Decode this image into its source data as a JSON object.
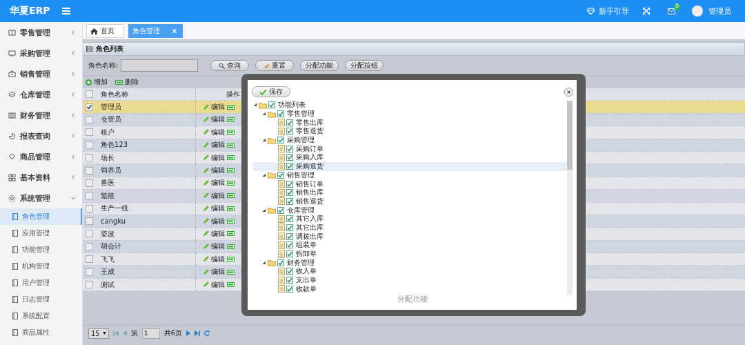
{
  "header": {
    "logo": "华夏ERP",
    "guide": "新手引导",
    "mail_badge": "0",
    "user": "管理员"
  },
  "sidebar": {
    "items": [
      {
        "label": "零售管理",
        "expanded": false
      },
      {
        "label": "采购管理",
        "expanded": false
      },
      {
        "label": "销售管理",
        "expanded": false
      },
      {
        "label": "仓库管理",
        "expanded": false
      },
      {
        "label": "财务管理",
        "expanded": false
      },
      {
        "label": "报表查询",
        "expanded": false
      },
      {
        "label": "商品管理",
        "expanded": false
      },
      {
        "label": "基本资料",
        "expanded": false
      },
      {
        "label": "系统管理",
        "expanded": true,
        "children": [
          {
            "label": "角色管理",
            "selected": true
          },
          {
            "label": "应用管理",
            "selected": false
          },
          {
            "label": "功能管理",
            "selected": false
          },
          {
            "label": "机构管理",
            "selected": false
          },
          {
            "label": "用户管理",
            "selected": false
          },
          {
            "label": "日志管理",
            "selected": false
          },
          {
            "label": "系统配置",
            "selected": false
          },
          {
            "label": "商品属性",
            "selected": false
          }
        ]
      }
    ]
  },
  "tabs": [
    {
      "label": "首页",
      "selected": false,
      "closable": false
    },
    {
      "label": "角色管理",
      "selected": true,
      "closable": true
    }
  ],
  "panel": {
    "title": "角色列表",
    "search_label": "角色名称:",
    "buttons": [
      "查询",
      "重置",
      "分配功能",
      "分配按钮"
    ],
    "toolbar": [
      "增加",
      "删除"
    ]
  },
  "table": {
    "all_checked": false,
    "columns": [
      "角色名称",
      "操作"
    ],
    "rows": [
      {
        "name": "管理员",
        "selected": true,
        "edit": "编辑"
      },
      {
        "name": "仓管员",
        "selected": false,
        "edit": "编辑"
      },
      {
        "name": "租户",
        "selected": false,
        "edit": "编辑"
      },
      {
        "name": "角色123",
        "selected": false,
        "edit": "编辑"
      },
      {
        "name": "场长",
        "selected": false,
        "edit": "编辑"
      },
      {
        "name": "饲养员",
        "selected": false,
        "edit": "编辑"
      },
      {
        "name": "兽医",
        "selected": false,
        "edit": "编辑"
      },
      {
        "name": "繁殖",
        "selected": false,
        "edit": "编辑"
      },
      {
        "name": "生产一线",
        "selected": false,
        "edit": "编辑"
      },
      {
        "name": "cangku",
        "selected": false,
        "edit": "编辑"
      },
      {
        "name": "姿波",
        "selected": false,
        "edit": "编辑"
      },
      {
        "name": "胡会计",
        "selected": false,
        "edit": "编辑"
      },
      {
        "name": "飞飞",
        "selected": false,
        "edit": "编辑"
      },
      {
        "name": "王成",
        "selected": false,
        "edit": "编辑"
      },
      {
        "name": "测试",
        "selected": false,
        "edit": "编辑"
      }
    ]
  },
  "pager": {
    "page_size": "15",
    "page_prefix": "第",
    "page": "1",
    "total": "共6页"
  },
  "dialog": {
    "save": "保存",
    "footer": "分配功能",
    "tree": {
      "label": "功能列表",
      "checked": true,
      "expanded": true,
      "selected": false,
      "children": [
        {
          "label": "零售管理",
          "checked": true,
          "expanded": true,
          "selected": false,
          "children": [
            {
              "label": "零售出库",
              "checked": true,
              "selected": false
            },
            {
              "label": "零售退货",
              "checked": true,
              "selected": false
            }
          ]
        },
        {
          "label": "采购管理",
          "checked": true,
          "expanded": true,
          "selected": false,
          "children": [
            {
              "label": "采购订单",
              "checked": true,
              "selected": false
            },
            {
              "label": "采购入库",
              "checked": true,
              "selected": false
            },
            {
              "label": "采购退货",
              "checked": true,
              "selected": true
            }
          ]
        },
        {
          "label": "销售管理",
          "checked": true,
          "expanded": true,
          "selected": false,
          "children": [
            {
              "label": "销售订单",
              "checked": true,
              "selected": false
            },
            {
              "label": "销售出库",
              "checked": true,
              "selected": false
            },
            {
              "label": "销售退货",
              "checked": true,
              "selected": false
            }
          ]
        },
        {
          "label": "仓库管理",
          "checked": true,
          "expanded": true,
          "selected": false,
          "children": [
            {
              "label": "其它入库",
              "checked": true,
              "selected": false
            },
            {
              "label": "其它出库",
              "checked": true,
              "selected": false
            },
            {
              "label": "调拨出库",
              "checked": true,
              "selected": false
            },
            {
              "label": "组装单",
              "checked": true,
              "selected": false
            },
            {
              "label": "拆卸单",
              "checked": true,
              "selected": false
            }
          ]
        },
        {
          "label": "财务管理",
          "checked": true,
          "expanded": true,
          "selected": false,
          "children": [
            {
              "label": "收入单",
              "checked": true,
              "selected": false
            },
            {
              "label": "支出单",
              "checked": true,
              "selected": false
            },
            {
              "label": "收款单",
              "checked": true,
              "selected": false
            }
          ]
        }
      ]
    }
  }
}
